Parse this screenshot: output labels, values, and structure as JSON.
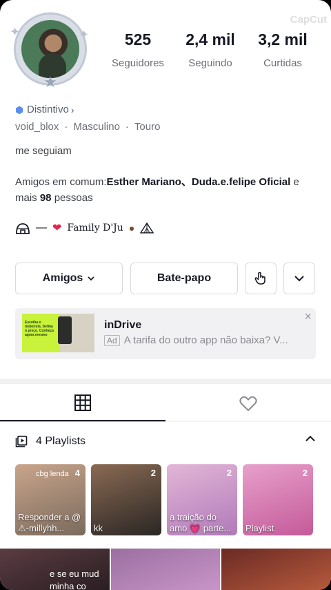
{
  "watermark": "CapCut",
  "stats": [
    {
      "value": "525",
      "label": "Seguidores"
    },
    {
      "value": "2,4 mil",
      "label": "Seguindo"
    },
    {
      "value": "3,2 mil",
      "label": "Curtidas"
    }
  ],
  "profile": {
    "distintivo": "Distintivo",
    "username": "void_blox",
    "gender": "Masculino",
    "sign": "Touro",
    "bio": "me seguiam",
    "mutual_prefix": "Amigos em comum:",
    "mutual_names": "Esther Mariano、Duda.e.felipe Oficial",
    "mutual_middle": " e mais ",
    "mutual_count": "98",
    "mutual_suffix": " pessoas",
    "family_prefix": "—",
    "family_name": "Family D'Ju",
    "family_heart": "❤"
  },
  "buttons": {
    "friends": "Amigos",
    "chat": "Bate-papo"
  },
  "ad": {
    "title": "inDrive",
    "tag": "Ad",
    "text": "A tarifa do outro app não baixa? V...",
    "thumb_text": "Escolha o motorista. Defina o preço. Conheça agora mesmo"
  },
  "playlists": {
    "header": "4 Playlists",
    "items": [
      {
        "count": "4",
        "top": "cbg lenda",
        "title": "Responder a @ ⚠-millyhh...",
        "colors": [
          "#7a6a5c",
          "#c9a58c"
        ]
      },
      {
        "count": "2",
        "top": "",
        "title": "kk",
        "colors": [
          "#2a2624",
          "#8a6a54"
        ]
      },
      {
        "count": "2",
        "top": "",
        "title": "a traição do amo 💗 parte...",
        "colors": [
          "#b07ab8",
          "#e3b6d8"
        ]
      },
      {
        "count": "2",
        "top": "",
        "title": "Playlist",
        "colors": [
          "#c45a9a",
          "#e7a0cb"
        ]
      }
    ]
  },
  "videos": [
    {
      "caption": "e se eu mud\nminha co",
      "colors": [
        "#2a1e22",
        "#5a3c42"
      ]
    },
    {
      "caption": "",
      "colors": [
        "#c995c8",
        "#9b6fa0"
      ]
    },
    {
      "caption": "",
      "colors": [
        "#b65a3c",
        "#6a2a24"
      ]
    }
  ]
}
